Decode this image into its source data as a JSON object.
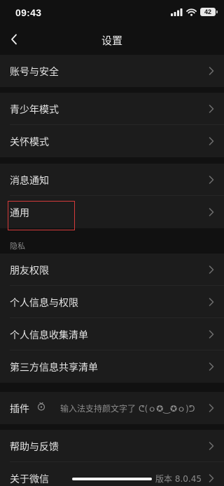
{
  "status_bar": {
    "time": "09:43",
    "battery": "42"
  },
  "nav": {
    "title": "设置"
  },
  "groups": [
    {
      "items": [
        {
          "label": "账号与安全"
        }
      ]
    },
    {
      "items": [
        {
          "label": "青少年模式"
        },
        {
          "label": "关怀模式"
        }
      ]
    },
    {
      "items": [
        {
          "label": "消息通知"
        },
        {
          "label": "通用"
        }
      ]
    },
    {
      "header": "隐私",
      "items": [
        {
          "label": "朋友权限"
        },
        {
          "label": "个人信息与权限"
        },
        {
          "label": "个人信息收集清单"
        },
        {
          "label": "第三方信息共享清单"
        }
      ]
    },
    {
      "items": [
        {
          "label": "插件",
          "note": "输入法支持颜文字了 ᕦ(ｏ✪‿✪ｏ)ᕤ"
        }
      ]
    },
    {
      "items": [
        {
          "label": "帮助与反馈"
        },
        {
          "label": "关于微信",
          "version": "版本 8.0.45"
        }
      ]
    }
  ],
  "icons": {
    "back": "chevron-left-icon",
    "chevron": "chevron-right-icon",
    "plugin": "plugin-icon",
    "signal": "cellular-signal-icon",
    "wifi": "wifi-icon",
    "battery": "battery-icon"
  },
  "colors": {
    "background": "#111111",
    "row": "#1c1c1c",
    "highlight": "#d43a3a"
  }
}
